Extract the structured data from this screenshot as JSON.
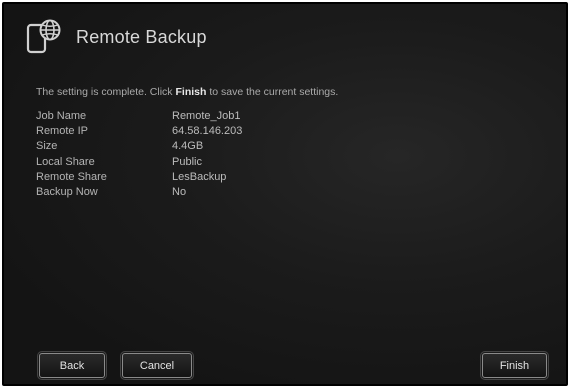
{
  "header": {
    "title": "Remote Backup",
    "icon": "remote-backup-icon"
  },
  "message": {
    "prefix": "The setting is complete. Click",
    "emphasis": "Finish",
    "suffix": "to save the current settings."
  },
  "summary": [
    {
      "label": "Job Name",
      "value": "Remote_Job1"
    },
    {
      "label": "Remote IP",
      "value": "64.58.146.203"
    },
    {
      "label": "Size",
      "value": "4.4GB"
    },
    {
      "label": "Local Share",
      "value": "Public"
    },
    {
      "label": "Remote Share",
      "value": "LesBackup"
    },
    {
      "label": "Backup Now",
      "value": "No"
    }
  ],
  "buttons": {
    "back": "Back",
    "cancel": "Cancel",
    "finish": "Finish"
  },
  "colors": {
    "background": "#151515",
    "text": "#c8c8c8",
    "frame": "#000000"
  }
}
